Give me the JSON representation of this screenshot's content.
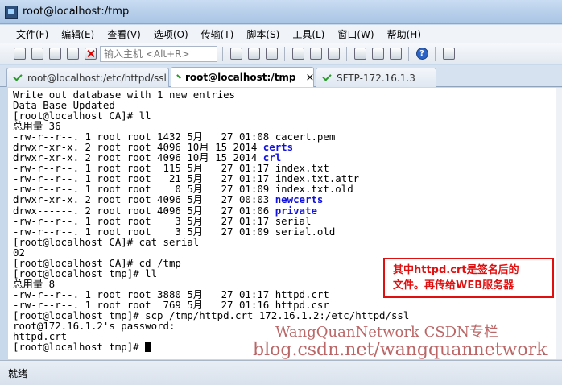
{
  "window": {
    "title": "root@localhost:/tmp"
  },
  "menu": [
    "文件(F)",
    "编辑(E)",
    "查看(V)",
    "选项(O)",
    "传输(T)",
    "脚本(S)",
    "工具(L)",
    "窗口(W)",
    "帮助(H)"
  ],
  "toolbar": {
    "host_placeholder": "输入主机 <Alt+R>"
  },
  "tabs": [
    {
      "label": "root@localhost:/etc/httpd/ssl",
      "active": false
    },
    {
      "label": "root@localhost:/tmp",
      "active": true,
      "close": "×"
    },
    {
      "label": "SFTP-172.16.1.3",
      "active": false
    }
  ],
  "terminal": {
    "lines": [
      "Write out database with 1 new entries",
      "Data Base Updated",
      "[root@localhost CA]# ll",
      "总用量 36",
      "-rw-r--r--. 1 root root 1432 5月   27 01:08 cacert.pem",
      "drwxr-xr-x. 2 root root 4096 10月 15 2014 certs",
      "drwxr-xr-x. 2 root root 4096 10月 15 2014 crl",
      "-rw-r--r--. 1 root root  115 5月   27 01:17 index.txt",
      "-rw-r--r--. 1 root root   21 5月   27 01:17 index.txt.attr",
      "-rw-r--r--. 1 root root    0 5月   27 01:09 index.txt.old",
      "drwxr-xr-x. 2 root root 4096 5月   27 00:03 newcerts",
      "drwx------. 2 root root 4096 5月   27 01:06 private",
      "-rw-r--r--. 1 root root    3 5月   27 01:17 serial",
      "-rw-r--r--. 1 root root    3 5月   27 01:09 serial.old",
      "[root@localhost CA]# cat serial",
      "02",
      "[root@localhost CA]# cd /tmp",
      "[root@localhost tmp]# ll",
      "总用量 8",
      "-rw-r--r--. 1 root root 3880 5月   27 01:17 httpd.crt",
      "-rw-r--r--. 1 root root  769 5月   27 01:16 httpd.csr",
      "[root@localhost tmp]# scp /tmp/httpd.crt 172.16.1.2:/etc/httpd/ssl",
      "root@172.16.1.2's password:",
      "httpd.crt",
      "[root@localhost tmp]# "
    ],
    "dir_names": [
      "certs",
      "crl",
      "newcerts",
      "private"
    ],
    "dir_color": "#1010e0"
  },
  "annotation": {
    "line1": "其中httpd.crt是签名后的",
    "line2": "文件。再传给WEB服务器"
  },
  "watermark": {
    "line1": "WangQuanNetwork CSDN专栏",
    "line2": "blog.csdn.net/wangquannetwork"
  },
  "status": {
    "text": "就绪"
  }
}
